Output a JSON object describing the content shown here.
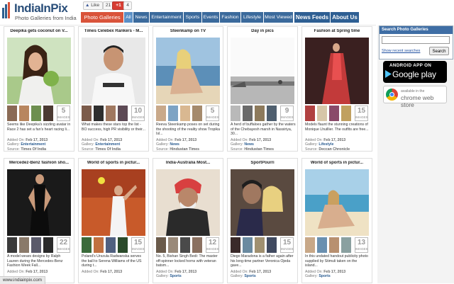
{
  "logo": {
    "title": "IndiaInPix",
    "subtitle": "Photo Galleries from India"
  },
  "social": {
    "like_label": "Like",
    "like_count": "21",
    "gplus_label": "+1",
    "gplus_count": "4"
  },
  "nav": {
    "items": [
      "Photo Galleries",
      "All",
      "News",
      "Entertainment",
      "Sports",
      "Events",
      "Fashion",
      "Lifestyle",
      "Most Viewed",
      "News Feeds",
      "About Us"
    ]
  },
  "sidebar": {
    "search_title": "Search Photo Galleries",
    "search_value": "",
    "recent_link": "Show recent searches",
    "search_button": "Search",
    "google_play_line1": "ANDROID APP ON",
    "google_play_line2": "Google play",
    "chrome_line1": "available in the",
    "chrome_line2": "chrome web store"
  },
  "cards": [
    {
      "title": "Deepika gets coconut on V...",
      "count": "5",
      "desc": "Seems like Deepika's sizzling avatar in Race 2 has set a fan's heart racing li...",
      "added": "Feb 17, 2013",
      "gallery": "Entertainment",
      "source": "Times Of India"
    },
    {
      "title": "Times Celebex Rankers - M...",
      "count": "10",
      "desc": "What makes these stars top the list - BO success, high PR visibility or their...",
      "added": "Feb 17, 2013",
      "gallery": "Entertainment",
      "source": "Times Of India"
    },
    {
      "title": "Steenkamp on TV",
      "count": "5",
      "desc": "Reeva Steenkamp poses on set during the shooting of the reality show Tropika Isl...",
      "added": "Feb 17, 2013",
      "gallery": "News",
      "source": "Hindustan Times"
    },
    {
      "title": "Day in pics",
      "count": "9",
      "desc": "A herd of buffaloes gather by the waters of the Chebayesh marsh in Nassiriya, 30...",
      "added": "Feb 17, 2013",
      "gallery": "News",
      "source": "Hindustan Times"
    },
    {
      "title": "Fashion at Spring time",
      "count": "15",
      "desc": "Models flaunt the stunning creations of Monique Lhuillier. The outfits are free...",
      "added": "Feb 17, 2013",
      "gallery": "Lifestyle",
      "source": "Deccan Chronicle"
    },
    {
      "title": "Mercedez-Benz fashion sho...",
      "count": "22",
      "desc": "A model wears designs by Ralph Lauren during the Mercedes-Benz Fashion Week Fall...",
      "added": "Feb 17, 2013",
      "gallery": "",
      "source": ""
    },
    {
      "title": "World of sports in pictur...",
      "count": "15",
      "desc": "Poland's Urszula Radwanska serves the ball to Serena Williams of the US during t...",
      "added": "Feb 17, 2013",
      "gallery": "",
      "source": ""
    },
    {
      "title": "India-Australia Most...",
      "count": "12",
      "desc": "No. 5, Bishan Singh Bedi: The master off-spinner locked horns with veteran batsm...",
      "added": "Feb 17, 2013",
      "gallery": "Sports",
      "source": ""
    },
    {
      "title": "SportPourri",
      "count": "15",
      "desc": "Diego Maradona is a father again after his long-time partner Veronica Ojeda gave...",
      "added": "Feb 17, 2013",
      "gallery": "Sports",
      "source": ""
    },
    {
      "title": "World of sports in pictur...",
      "count": "13",
      "desc": "In this undated handout publicity photo supplied by Stimuli taken on the island...",
      "added": "Feb 17, 2013",
      "gallery": "Sports",
      "source": ""
    }
  ],
  "labels": {
    "added_on": "Added On:",
    "gallery": "Gallery:",
    "source": "Source:",
    "images": "IMAGES"
  },
  "status_url": "www.indiainpix.com"
}
